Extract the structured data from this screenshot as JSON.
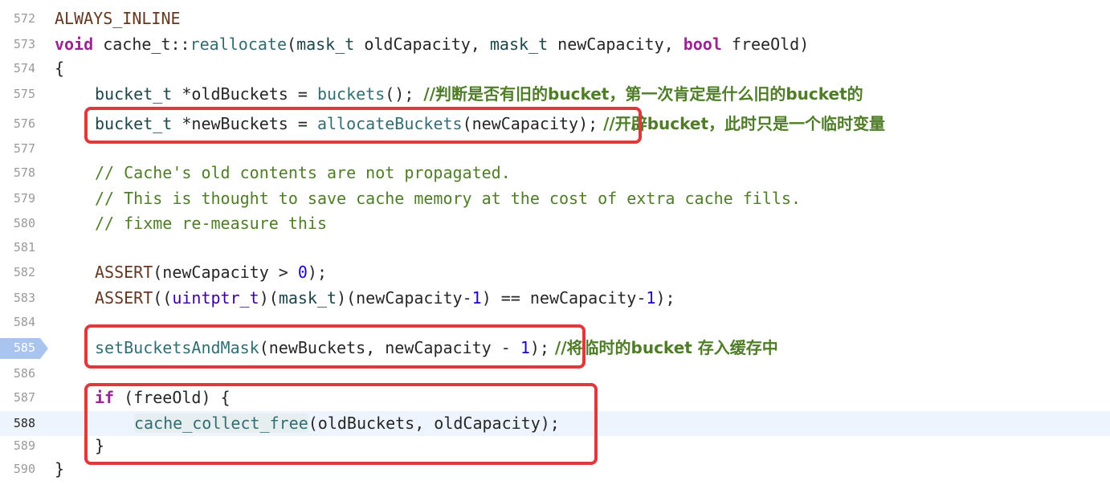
{
  "lines": [
    {
      "num": "572",
      "text": "ALWAYS_INLINE"
    },
    {
      "num": "573",
      "kw_void": "void",
      "sig_a": " cache_t::",
      "fn": "reallocate",
      "sig_b": "(",
      "t1": "mask_t",
      "p1": " oldCapacity, ",
      "t2": "mask_t",
      "p2": " newCapacity, ",
      "kw_bool": "bool",
      "p3": " freeOld)"
    },
    {
      "num": "574",
      "text": "{"
    },
    {
      "num": "575",
      "type": "bucket_t",
      "mid": " *oldBuckets = ",
      "fn": "buckets",
      "tail": "(); ",
      "comment": "//判断是否有旧的bucket，第一次肯定是什么旧的bucket的"
    },
    {
      "num": "576",
      "type": "bucket_t",
      "mid": " *newBuckets = ",
      "fn": "allocateBuckets",
      "tail": "(newCapacity);",
      "comment": " //开辟bucket，此时只是一个临时变量"
    },
    {
      "num": "577"
    },
    {
      "num": "578",
      "comment": "// Cache's old contents are not propagated."
    },
    {
      "num": "579",
      "comment": "// This is thought to save cache memory at the cost of extra cache fills."
    },
    {
      "num": "580",
      "comment": "// fixme re-measure this"
    },
    {
      "num": "581"
    },
    {
      "num": "582",
      "macro": "ASSERT",
      "a": "(newCapacity > ",
      "n": "0",
      "b": ");"
    },
    {
      "num": "583",
      "macro": "ASSERT",
      "a": "((",
      "t": "uintptr_t",
      "b": ")(",
      "t2": "mask_t",
      "c": ")(newCapacity-",
      "n1": "1",
      "d": ") == newCapacity-",
      "n2": "1",
      "e": ");"
    },
    {
      "num": "584"
    },
    {
      "num": "585",
      "fn": "setBucketsAndMask",
      "a": "(newBuckets, newCapacity - ",
      "n": "1",
      "b": ");",
      "comment": " //将临时的bucket 存入缓存中"
    },
    {
      "num": "586"
    },
    {
      "num": "587",
      "kw": "if",
      "a": " (freeOld) {"
    },
    {
      "num": "588",
      "fn": "cache_collect_free",
      "a": "(oldBuckets, oldCapacity);"
    },
    {
      "num": "589",
      "text": "}"
    },
    {
      "num": "590",
      "text": "}"
    }
  ],
  "colors": {
    "keyword": "#9b2393",
    "comment": "#4f7d27",
    "number": "#1c00cf",
    "highlight_box": "#e0383b",
    "breakpoint": "#a9c4ef",
    "current_line": "#eef4fd"
  }
}
